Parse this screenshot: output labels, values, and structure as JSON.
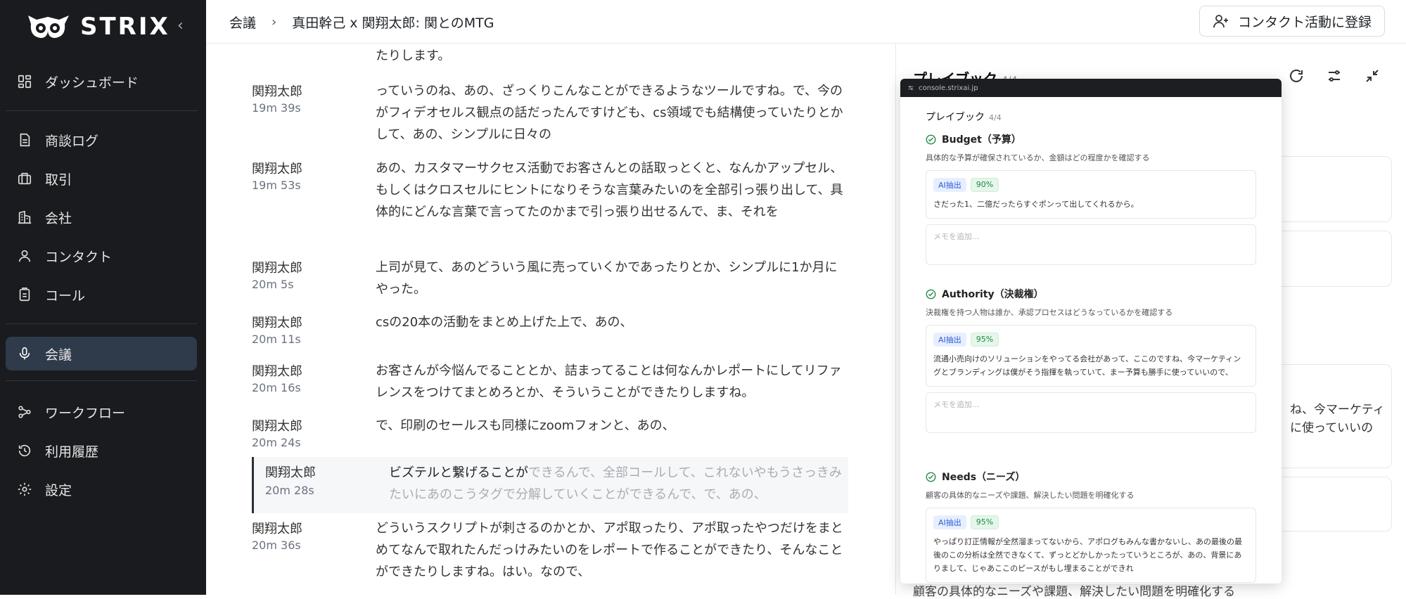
{
  "sidebar": {
    "logo": "STRIX",
    "items": [
      {
        "label": "ダッシュボード",
        "icon": "dashboard-icon"
      },
      {
        "label": "商談ログ",
        "icon": "document-icon"
      },
      {
        "label": "取引",
        "icon": "briefcase-icon"
      },
      {
        "label": "会社",
        "icon": "building-icon"
      },
      {
        "label": "コンタクト",
        "icon": "user-icon"
      },
      {
        "label": "コール",
        "icon": "clipboard-icon"
      },
      {
        "label": "会議",
        "icon": "microphone-icon",
        "active": true
      },
      {
        "label": "ワークフロー",
        "icon": "workflow-icon"
      },
      {
        "label": "利用履歴",
        "icon": "history-icon"
      },
      {
        "label": "設定",
        "icon": "gear-icon"
      }
    ]
  },
  "header": {
    "breadcrumb_root": "会議",
    "breadcrumb_current": "真田幹己 x 関翔太郎: 関とのMTG",
    "register_button": "コンタクト活動に登録"
  },
  "transcript": {
    "top_fragment": "たりします。",
    "entries": [
      {
        "speaker": "関翔太郎",
        "time": "19m 39s",
        "text": "っていうのね、あの、ざっくりこんなことができるようなツールですね。で、今のがフィデオセルス観点の話だったんですけども、cs領域でも結構使っていたりとかして、あの、シンプルに日々の"
      },
      {
        "speaker": "関翔太郎",
        "time": "19m 53s",
        "text": "あの、カスタマーサクセス活動でお客さんとの話取っとくと、なんかアップセル、もしくはクロスセルにヒントになりそうな言葉みたいのを全部引っ張り出して、具体的にどんな言葉で言ってたのかまで引っ張り出せるんで、ま、それを"
      },
      {
        "speaker": "関翔太郎",
        "time": "20m 5s",
        "text": "上司が見て、あのどういう風に売っていくかであったりとか、シンプルに1か月にやった。"
      },
      {
        "speaker": "関翔太郎",
        "time": "20m 11s",
        "text": "csの20本の活動をまとめ上げた上で、あの、"
      },
      {
        "speaker": "関翔太郎",
        "time": "20m 16s",
        "text": "お客さんが今悩んでることとか、詰まってることは何なんかレポートにしてリファレンスをつけてまとめろとか、そういうことができたりしますね。"
      },
      {
        "speaker": "関翔太郎",
        "time": "20m 24s",
        "text": "で、印刷のセールスも同様にzoomフォンと、あの、"
      },
      {
        "speaker": "関翔太郎",
        "time": "20m 28s",
        "text_spoken": "ビズテルと繋げることが",
        "text_rest": "できるんで、全部コールして、これないやもうさっきみたいにあのこうタグで分解していくことができるんで、で、あの、",
        "active": true
      },
      {
        "speaker": "関翔太郎",
        "time": "20m 36s",
        "text": "どういうスクリプトが刺さるのかとか、アポ取ったり、アポ取ったやつだけをまとめてなんで取れたんだっけみたいのをレポートで作ることができたり、そんなことができたりしますね。はい。なので、"
      }
    ]
  },
  "background_panel": {
    "title": "プレイブック",
    "count": "4/4",
    "card1_text_line1": "ね、今マーケティ",
    "card1_text_line2": "に使っていいの",
    "bottom_text": "顧客の具体的なニーズや課題、解決したい問題を明確化する"
  },
  "overlay": {
    "url": "console.strixai.jp",
    "title": "プレイブック",
    "count": "4/4",
    "memo_placeholder": "メモを追加...",
    "ai_badge": "AI抽出",
    "criteria": [
      {
        "name": "Budget（予算）",
        "desc": "具体的な予算が確保されているか、金額はどの程度かを確認する",
        "pct": "90%",
        "evidence": "さだった1、二億だったらすぐポンって出してくれるから。"
      },
      {
        "name": "Authority（決裁権）",
        "desc": "決裁権を持つ人物は誰か、承認プロセスはどうなっているかを確認する",
        "pct": "95%",
        "evidence": "流通小売向けのソリューションをやってる会社があって、ここのですね、今マーケティングとブランディングは僕がそう指揮を執っていて、まー予算も勝手に使っていいので、"
      },
      {
        "name": "Needs（ニーズ）",
        "desc": "顧客の具体的なニーズや課題、解決したい問題を明確化する",
        "pct": "95%",
        "evidence": "やっぱり訂正情報が全然溜まってないから、アポログもみんな書かないし、あの最後の最後のこの分析は全然できなくて、ずっとどかしかったっていうところが、あの、背景にありまして、じゃあここのピースがもし埋まることができれ"
      }
    ]
  },
  "colors": {
    "sidebar_bg": "#1a1b1e",
    "active_nav": "#2f3a4a",
    "ai_badge": "#2b5bd7",
    "pct_badge": "#1f8a42"
  }
}
